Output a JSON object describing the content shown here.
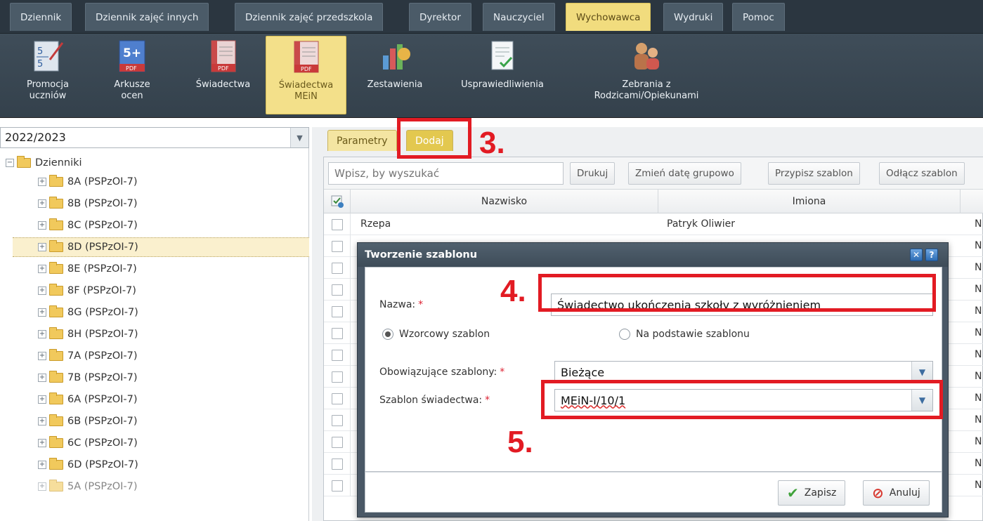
{
  "menu": [
    {
      "label": "Dziennik",
      "active": false
    },
    {
      "label": "Dziennik zajęć innych",
      "active": false
    },
    {
      "label": "Dziennik zajęć przedszkola",
      "active": false
    },
    {
      "label": "Dyrektor",
      "active": false
    },
    {
      "label": "Nauczyciel",
      "active": false
    },
    {
      "label": "Wychowawca",
      "active": true
    },
    {
      "label": "Wydruki",
      "active": false
    },
    {
      "label": "Pomoc",
      "active": false
    }
  ],
  "toolbar": [
    {
      "label": "Promocja\nuczniów",
      "icon": "promotion-icon"
    },
    {
      "label": "Arkusze\nocen",
      "icon": "grade-sheet-pdf-icon",
      "badge": "5+",
      "sub": "PDF"
    },
    {
      "label": "Świadectwa",
      "icon": "certificates-pdf-icon",
      "sub": "PDF"
    },
    {
      "label": "Świadectwa\nMEiN",
      "icon": "certificates-mein-pdf-icon",
      "sub": "PDF",
      "selected": true
    },
    {
      "label": "Zestawienia",
      "icon": "statistics-icon"
    },
    {
      "label": "Usprawiedliwienia",
      "icon": "excuses-icon"
    },
    {
      "label": "Zebrania z\nRodzicami/Opiekunami",
      "icon": "parents-meeting-icon"
    }
  ],
  "year": {
    "value": "2022/2023"
  },
  "tree": {
    "root": "Dzienniki",
    "items": [
      "8A (PSPzOI-7)",
      "8B (PSPzOI-7)",
      "8C (PSPzOI-7)",
      "8D (PSPzOI-7)",
      "8E (PSPzOI-7)",
      "8F (PSPzOI-7)",
      "8G (PSPzOI-7)",
      "8H (PSPzOI-7)",
      "7A (PSPzOI-7)",
      "7B (PSPzOI-7)",
      "6A (PSPzOI-7)",
      "6B (PSPzOI-7)",
      "6C (PSPzOI-7)",
      "6D (PSPzOI-7)",
      "5A (PSPzOI-7)"
    ],
    "selected_index": 3
  },
  "tabs": [
    {
      "label": "Parametry"
    },
    {
      "label": "Dodaj"
    }
  ],
  "grid": {
    "search_placeholder": "Wpisz, by wyszukać",
    "buttons": [
      "Drukuj",
      "Zmień datę grupowo",
      "Przypisz szablon",
      "Odłącz szablon"
    ],
    "columns": [
      "Nazwisko",
      "Imiona"
    ],
    "first_row": {
      "surname": "Rzepa",
      "names": "Patryk Oliwier"
    },
    "edge_letter": "N",
    "row_count": 13
  },
  "dialog": {
    "title": "Tworzenie szablonu",
    "name_label": "Nazwa:",
    "name_value": "Świadectwo ukończenia szkoły z wyróżnieniem",
    "radio1": "Wzorcowy szablon",
    "radio2": "Na podstawie szablonu",
    "radio_selected": "Wzorcowy szablon",
    "templates_label": "Obowiązujące szablony:",
    "templates_value": "Bieżące",
    "cert_label": "Szablon świadectwa:",
    "cert_value": "MEiN-I/10/1",
    "required_mark": "*",
    "save": "Zapisz",
    "cancel": "Anuluj"
  },
  "annotations": [
    "3.",
    "4.",
    "5."
  ],
  "colors": {
    "annotation_red": "#e21b23",
    "active_menu": "#f1dc7e",
    "selected_tree_row": "#faf0ce"
  }
}
